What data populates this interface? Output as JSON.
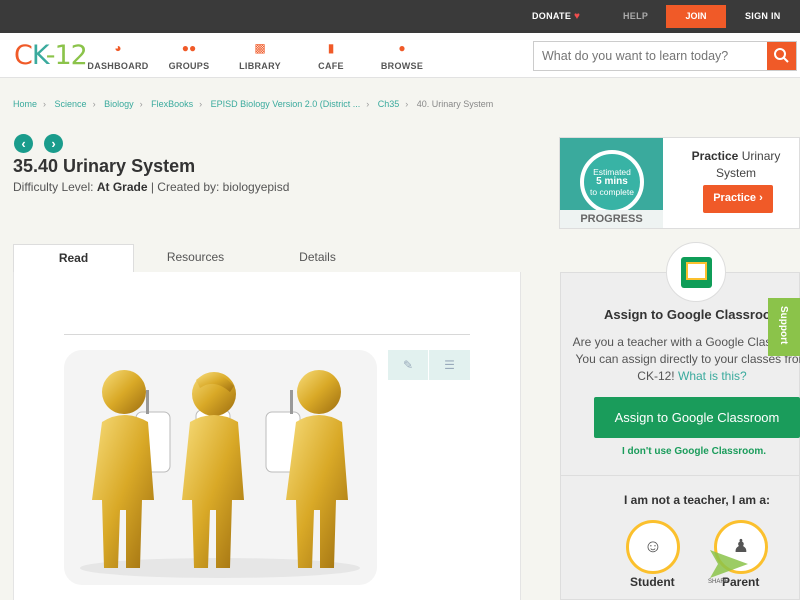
{
  "topbar": {
    "donate": "DONATE",
    "help": "HELP",
    "join": "JOIN",
    "signin": "SIGN IN"
  },
  "logo": {
    "c": "C",
    "k": "K",
    "dash": "-",
    "num": "12"
  },
  "nav": [
    {
      "label": "DASHBOARD",
      "icon": "dashboard-icon"
    },
    {
      "label": "GROUPS",
      "icon": "groups-icon"
    },
    {
      "label": "LIBRARY",
      "icon": "library-icon"
    },
    {
      "label": "CAFE",
      "icon": "cafe-icon"
    },
    {
      "label": "BROWSE",
      "icon": "browse-icon"
    }
  ],
  "search": {
    "placeholder": "What do you want to learn today?"
  },
  "breadcrumb": [
    "Home",
    "Science",
    "Biology",
    "FlexBooks",
    "EPISD Biology Version 2.0 (District ...",
    "Ch35",
    "40. Urinary System"
  ],
  "page": {
    "title": "35.40 Urinary System",
    "difficulty_label": "Difficulty Level:",
    "difficulty_value": "At Grade",
    "created_by": "| Created by: biologyepisd"
  },
  "tabs": [
    "Read",
    "Resources",
    "Details"
  ],
  "practice": {
    "estimated": "Estimated",
    "mins": "5 mins",
    "to_complete": "to complete",
    "progress": "PROGRESS",
    "title_bold": "Practice",
    "title_rest": "Urinary System",
    "button": "Practice"
  },
  "classroom": {
    "title": "Assign to Google Classroom",
    "desc": "Are you a teacher with a Google Classroom? You can assign directly to your classes from CK-12!",
    "what": "What is this?",
    "button": "Assign to Google Classroom",
    "no": "I don't use Google Classroom.",
    "not_teacher": "I am not a teacher, I am a:",
    "student": "Student",
    "parent": "Parent"
  },
  "support": "Support",
  "share": "SHARE",
  "colors": {
    "accent": "#f05a28",
    "teal": "#3aaa9d",
    "green": "#1a9c5b",
    "dark": "#3a3a3a"
  }
}
